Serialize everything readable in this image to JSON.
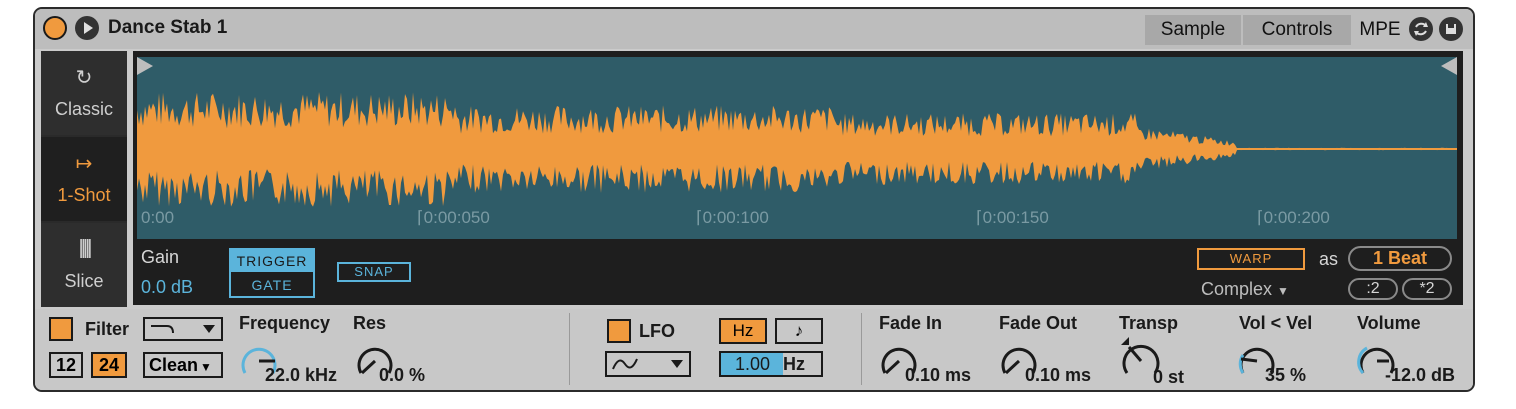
{
  "header": {
    "title": "Dance Stab 1",
    "tabs": [
      "Sample",
      "Controls"
    ],
    "mpe_label": "MPE"
  },
  "modes": [
    {
      "label": "Classic",
      "icon": "loop-arrow-icon"
    },
    {
      "label": "1-Shot",
      "icon": "arrow-to-line-icon"
    },
    {
      "label": "Slice",
      "icon": "slice-bars-icon"
    }
  ],
  "timeline": [
    "0:00",
    "0:00:050",
    "0:00:100",
    "0:00:150",
    "0:00:200"
  ],
  "sample": {
    "gain_label": "Gain",
    "gain_value": "0.0 dB",
    "trigger_label": "TRIGGER",
    "gate_label": "GATE",
    "snap_label": "SNAP",
    "warp_label": "WARP",
    "as_label": "as",
    "beat_value": "1 Beat",
    "warp_mode": "Complex",
    "half_label": ":2",
    "double_label": "*2"
  },
  "filter": {
    "label": "Filter",
    "slope_12": "12",
    "slope_24": "24",
    "circuit": "Clean",
    "frequency_label": "Frequency",
    "frequency_value": "22.0 kHz",
    "res_label": "Res",
    "res_value": "0.0 %"
  },
  "lfo": {
    "label": "LFO",
    "hz_label": "Hz",
    "note_label": "♪",
    "rate_value": "1.00",
    "rate_unit": "Hz"
  },
  "knobs": [
    {
      "label": "Fade In",
      "value": "0.10 ms"
    },
    {
      "label": "Fade Out",
      "value": "0.10 ms"
    },
    {
      "label": "Transp",
      "value": "0 st"
    },
    {
      "label": "Vol < Vel",
      "value": "35 %"
    },
    {
      "label": "Volume",
      "value": "-12.0 dB"
    }
  ],
  "colors": {
    "accent": "#f09a3e",
    "blue": "#5bb4db",
    "waveform_bg": "#2f5c68"
  }
}
